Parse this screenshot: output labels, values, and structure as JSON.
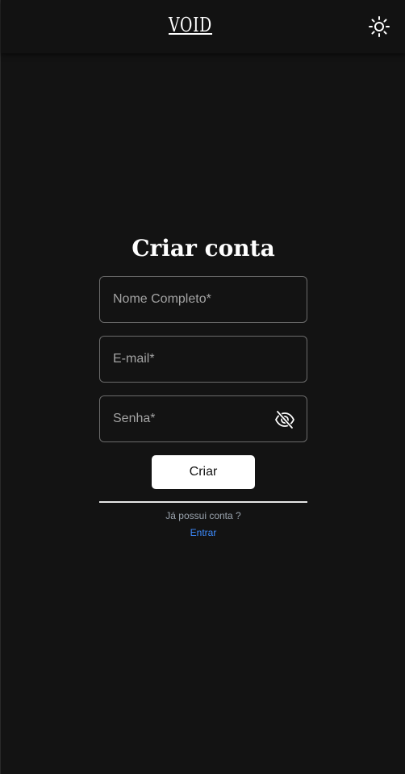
{
  "header": {
    "logo_text": "VOID",
    "theme_toggle_icon": "sun-icon"
  },
  "form": {
    "title": "Criar conta",
    "fields": [
      {
        "placeholder": "Nome Completo*",
        "value": ""
      },
      {
        "placeholder": "E-mail*",
        "value": ""
      },
      {
        "placeholder": "Senha*",
        "value": "",
        "icon": "eye-off-icon"
      }
    ],
    "submit_label": "Criar",
    "have_account_text": "Já possui conta ?",
    "login_link": "Entrar"
  },
  "colors": {
    "background": "#131313",
    "header": "#121212",
    "text": "#ffffff",
    "muted": "#9aa3ad",
    "link": "#3d8bfd",
    "border": "#6b6b6b"
  }
}
